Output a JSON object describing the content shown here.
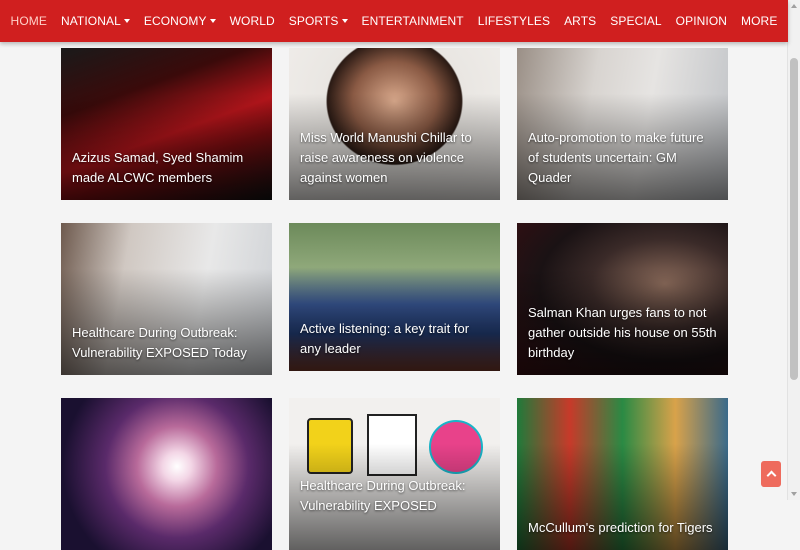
{
  "nav": {
    "items": [
      {
        "label": "HOME",
        "dropdown": false,
        "active": true
      },
      {
        "label": "NATIONAL",
        "dropdown": true,
        "active": false
      },
      {
        "label": "ECONOMY",
        "dropdown": true,
        "active": false
      },
      {
        "label": "WORLD",
        "dropdown": false,
        "active": false
      },
      {
        "label": "SPORTS",
        "dropdown": true,
        "active": false
      },
      {
        "label": "ENTERTAINMENT",
        "dropdown": false,
        "active": false
      },
      {
        "label": "LIFESTYLES",
        "dropdown": false,
        "active": false
      },
      {
        "label": "ARTS",
        "dropdown": false,
        "active": false
      },
      {
        "label": "SPECIAL",
        "dropdown": false,
        "active": false
      },
      {
        "label": "OPINION",
        "dropdown": false,
        "active": false
      },
      {
        "label": "MORE",
        "dropdown": false,
        "active": false
      }
    ]
  },
  "articles": [
    {
      "title": "Azizus Samad, Syed Shamim made ALCWC members",
      "image": "red-motorcycle"
    },
    {
      "title": "Miss World Manushi Chillar to raise awareness on violence against women",
      "image": "woman-portrait"
    },
    {
      "title": "Auto-promotion to make future of students uncertain: GM Quader",
      "image": "woman-with-phone"
    },
    {
      "title": "Healthcare During Outbreak: Vulnerability EXPOSED Today",
      "image": "worried-woman-phone"
    },
    {
      "title": "Active listening: a key trait for any leader",
      "image": "man-in-tv-studio"
    },
    {
      "title": "Salman Khan urges fans to not gather outside his house on 55th birthday",
      "image": "man-on-stage"
    },
    {
      "title": "",
      "image": "cosmic-explosion"
    },
    {
      "title": "Healthcare During Outbreak: Vulnerability EXPOSED",
      "image": "latest-news-graphics"
    },
    {
      "title": "McCullum's prediction for Tigers",
      "image": "cricket-fans"
    }
  ],
  "colors": {
    "brand": "#d01f1f",
    "back_to_top": "#ee6b5d"
  }
}
